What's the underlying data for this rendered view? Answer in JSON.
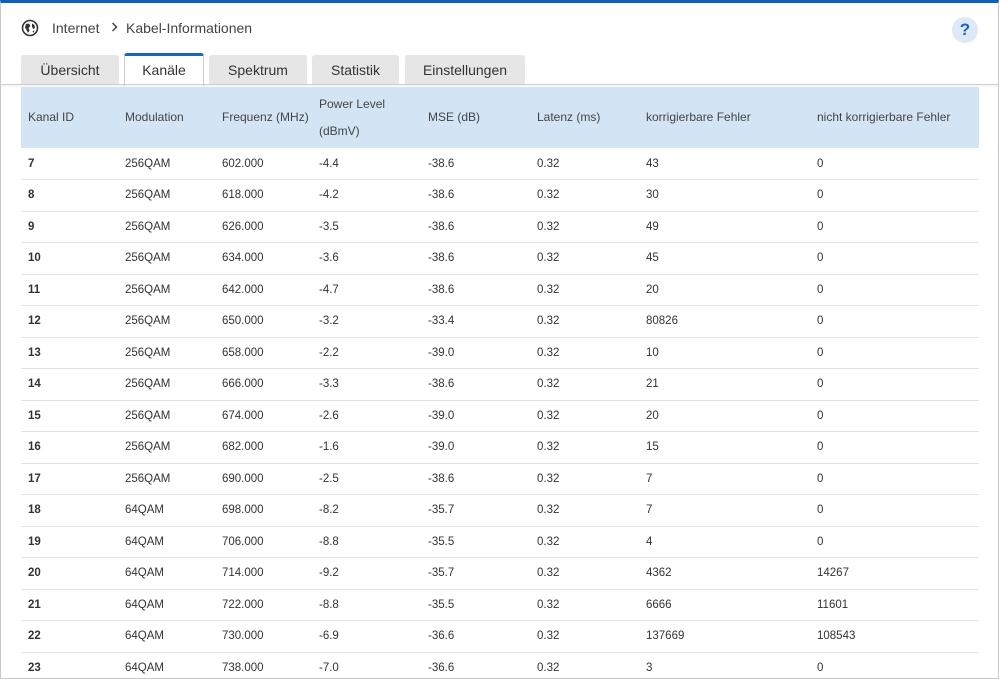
{
  "breadcrumb": {
    "section": "Internet",
    "page": "Kabel-Informationen"
  },
  "help_label": "?",
  "tabs": [
    {
      "label": "Übersicht",
      "active": false
    },
    {
      "label": "Kanäle",
      "active": true
    },
    {
      "label": "Spektrum",
      "active": false
    },
    {
      "label": "Statistik",
      "active": false
    },
    {
      "label": "Einstellungen",
      "active": false
    }
  ],
  "table": {
    "columns": [
      "Kanal ID",
      "Modulation",
      "Frequenz (MHz)",
      "Power Level (dBmV)",
      "MSE (dB)",
      "Latenz (ms)",
      "korrigierbare Fehler",
      "nicht korrigierbare Fehler"
    ],
    "power_level_line1": "Power Level",
    "power_level_line2": "(dBmV)",
    "rows": [
      [
        "7",
        "256QAM",
        "602.000",
        "-4.4",
        "-38.6",
        "0.32",
        "43",
        "0"
      ],
      [
        "8",
        "256QAM",
        "618.000",
        "-4.2",
        "-38.6",
        "0.32",
        "30",
        "0"
      ],
      [
        "9",
        "256QAM",
        "626.000",
        "-3.5",
        "-38.6",
        "0.32",
        "49",
        "0"
      ],
      [
        "10",
        "256QAM",
        "634.000",
        "-3.6",
        "-38.6",
        "0.32",
        "45",
        "0"
      ],
      [
        "11",
        "256QAM",
        "642.000",
        "-4.7",
        "-38.6",
        "0.32",
        "20",
        "0"
      ],
      [
        "12",
        "256QAM",
        "650.000",
        "-3.2",
        "-33.4",
        "0.32",
        "80826",
        "0"
      ],
      [
        "13",
        "256QAM",
        "658.000",
        "-2.2",
        "-39.0",
        "0.32",
        "10",
        "0"
      ],
      [
        "14",
        "256QAM",
        "666.000",
        "-3.3",
        "-38.6",
        "0.32",
        "21",
        "0"
      ],
      [
        "15",
        "256QAM",
        "674.000",
        "-2.6",
        "-39.0",
        "0.32",
        "20",
        "0"
      ],
      [
        "16",
        "256QAM",
        "682.000",
        "-1.6",
        "-39.0",
        "0.32",
        "15",
        "0"
      ],
      [
        "17",
        "256QAM",
        "690.000",
        "-2.5",
        "-38.6",
        "0.32",
        "7",
        "0"
      ],
      [
        "18",
        "64QAM",
        "698.000",
        "-8.2",
        "-35.7",
        "0.32",
        "7",
        "0"
      ],
      [
        "19",
        "64QAM",
        "706.000",
        "-8.8",
        "-35.5",
        "0.32",
        "4",
        "0"
      ],
      [
        "20",
        "64QAM",
        "714.000",
        "-9.2",
        "-35.7",
        "0.32",
        "4362",
        "14267"
      ],
      [
        "21",
        "64QAM",
        "722.000",
        "-8.8",
        "-35.5",
        "0.32",
        "6666",
        "11601"
      ],
      [
        "22",
        "64QAM",
        "730.000",
        "-6.9",
        "-36.6",
        "0.32",
        "137669",
        "108543"
      ],
      [
        "23",
        "64QAM",
        "738.000",
        "-7.0",
        "-36.6",
        "0.32",
        "3",
        "0"
      ]
    ]
  },
  "colors": {
    "accent": "#1a66b8",
    "header_bg": "#d3e5f4",
    "tab_inactive": "#e6e6e6"
  },
  "icons": {
    "globe": "globe-icon",
    "separator": "chevron-right-icon",
    "help": "help-icon"
  }
}
